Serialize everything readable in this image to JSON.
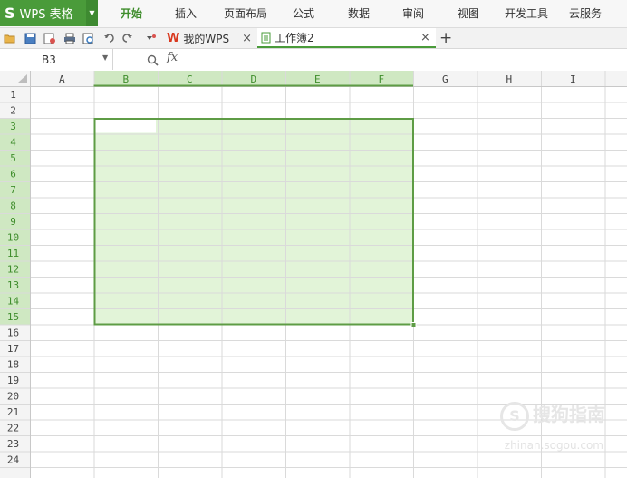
{
  "app": {
    "logo_label": "WPS 表格",
    "logo_mark": "S"
  },
  "menu": [
    {
      "label": "开始",
      "active": true
    },
    {
      "label": "插入"
    },
    {
      "label": "页面布局"
    },
    {
      "label": "公式"
    },
    {
      "label": "数据"
    },
    {
      "label": "审阅"
    },
    {
      "label": "视图"
    },
    {
      "label": "开发工具"
    },
    {
      "label": "云服务"
    }
  ],
  "tabs": {
    "mywps_label": "我的WPS",
    "book_label": "工作簿2",
    "close_glyph": "×",
    "new_glyph": "+"
  },
  "formula_bar": {
    "name_box": "B3",
    "fx_label": "fx",
    "formula": ""
  },
  "sheet": {
    "columns": [
      "A",
      "B",
      "C",
      "D",
      "E",
      "F",
      "G",
      "H",
      "I"
    ],
    "rows": [
      "1",
      "2",
      "3",
      "4",
      "5",
      "6",
      "7",
      "8",
      "9",
      "10",
      "11",
      "12",
      "13",
      "14",
      "15",
      "16",
      "17",
      "18",
      "19",
      "20",
      "21",
      "22",
      "23",
      "24"
    ],
    "selection": {
      "range": "B3:F15",
      "active_cell": "B3"
    },
    "colors": {
      "selection_fill": "#e2f4d8",
      "selection_border": "#5e9c45",
      "header_sel_bg": "#cfe8c2",
      "grid_line": "#dadada",
      "header_bg": "#f4f4f4"
    }
  },
  "watermark": {
    "text": "搜狗指南",
    "sub": "zhinan.sogou.com"
  }
}
